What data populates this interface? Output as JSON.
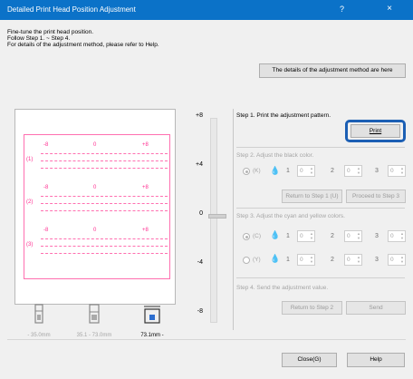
{
  "window": {
    "title": "Detailed Print Head Position Adjustment",
    "help_glyph": "?",
    "close_glyph": "×"
  },
  "intro": [
    "Fine-tune the print head position.",
    "Follow Step 1. ~ Step 4.",
    "For details of the adjustment method, please refer to Help."
  ],
  "details_button": "The details of the adjustment method are here",
  "pattern": {
    "columns": [
      "-8",
      "0",
      "+8"
    ],
    "rows": [
      "(1)",
      "(2)",
      "(3)"
    ]
  },
  "scale": {
    "ticks": [
      "+8",
      "+4",
      "0",
      "-4",
      "-8"
    ],
    "value": 0
  },
  "step1": {
    "label": "Step 1. Print the adjustment pattern.",
    "print_button": "Print"
  },
  "step2": {
    "label": "Step 2. Adjust the black color.",
    "channel": "(K)",
    "inputs": [
      {
        "num": "1",
        "value": "0"
      },
      {
        "num": "2",
        "value": "0"
      },
      {
        "num": "3",
        "value": "0"
      }
    ],
    "return_button": "Return to Step 1 (U)",
    "proceed_button": "Proceed to Step 3"
  },
  "step3": {
    "label": "Step 3. Adjust the cyan and yellow colors.",
    "channels": [
      {
        "name": "(C)",
        "inputs": [
          {
            "num": "1",
            "value": "0"
          },
          {
            "num": "2",
            "value": "0"
          },
          {
            "num": "3",
            "value": "0"
          }
        ]
      },
      {
        "name": "(Y)",
        "inputs": [
          {
            "num": "1",
            "value": "0"
          },
          {
            "num": "2",
            "value": "0"
          },
          {
            "num": "3",
            "value": "0"
          }
        ]
      }
    ]
  },
  "step4": {
    "label": "Step 4. Send the adjustment value.",
    "return_button": "Return to Step 2",
    "send_button": "Send"
  },
  "heads": [
    {
      "label": "- 35.0mm",
      "active": false
    },
    {
      "label": "35.1 - 73.0mm",
      "active": false
    },
    {
      "label": "73.1mm -",
      "active": true
    }
  ],
  "footer": {
    "close_button": "Close(G)",
    "help_button": "Help"
  },
  "colors": {
    "titlebar": "#0b72c8",
    "pattern": "#ff2d90",
    "focus_ring": "#1c5fb4"
  }
}
